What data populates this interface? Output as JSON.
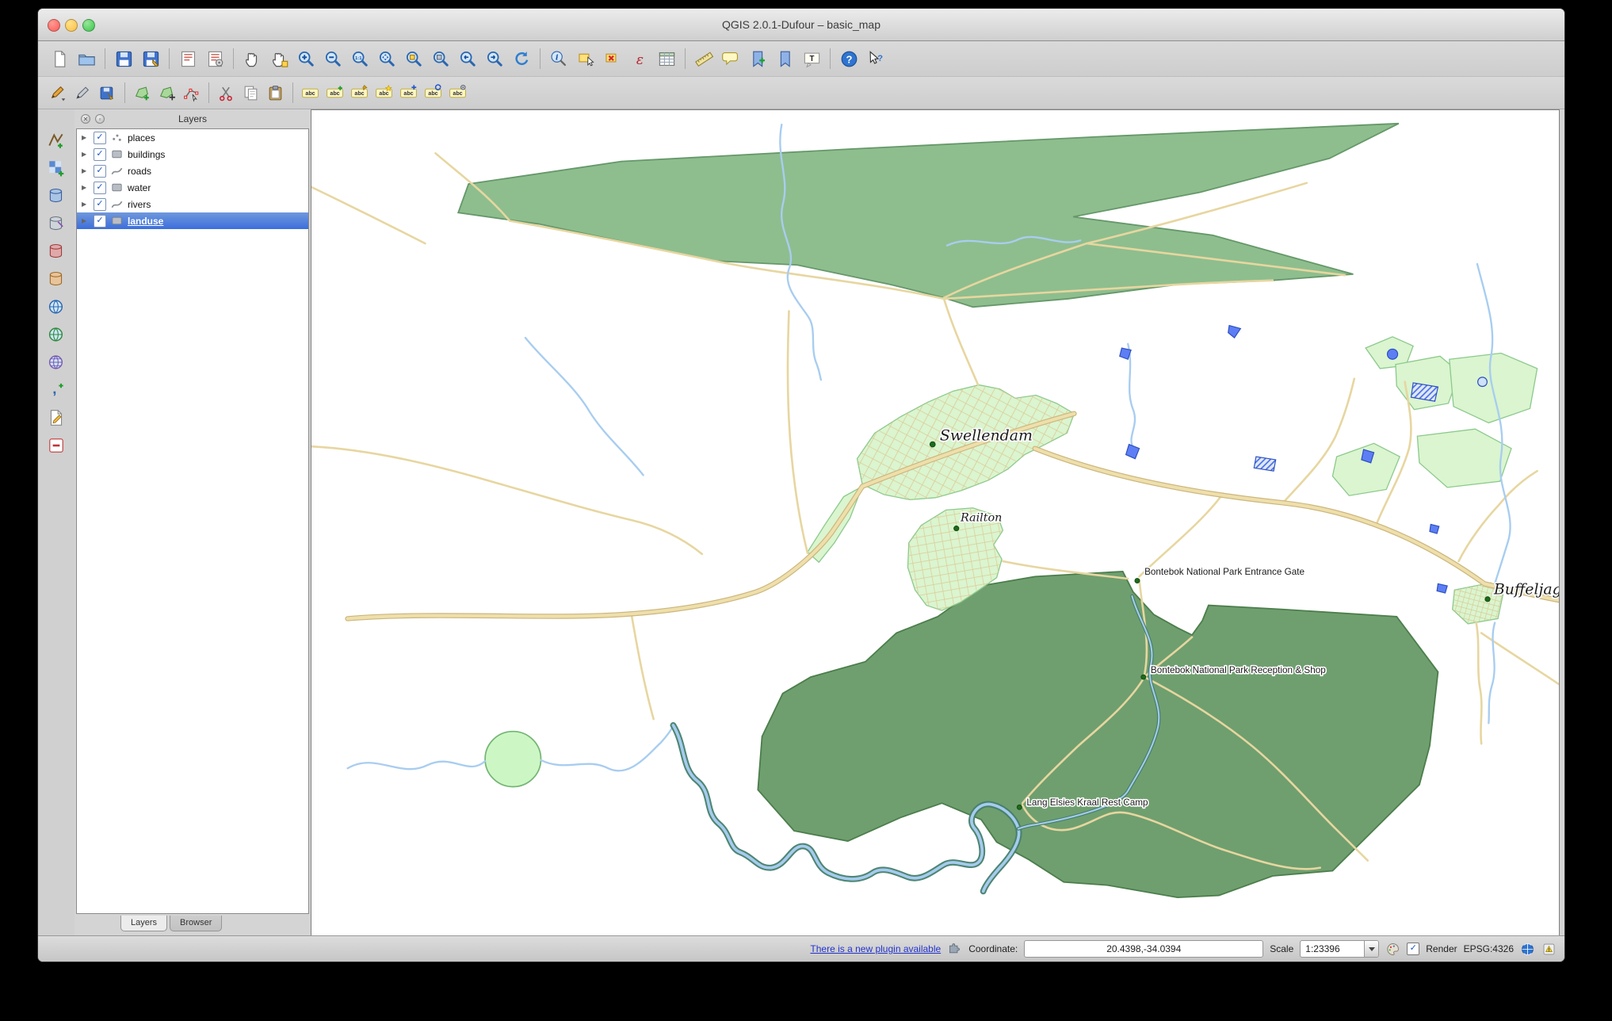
{
  "window": {
    "title": "QGIS 2.0.1-Dufour – basic_map"
  },
  "toolbar_main": {
    "items": [
      {
        "name": "new-project-button",
        "icon": "page"
      },
      {
        "name": "open-project-button",
        "icon": "folder"
      },
      {
        "sep": true
      },
      {
        "name": "save-project-button",
        "icon": "floppy"
      },
      {
        "name": "save-project-as-button",
        "icon": "floppy-edit"
      },
      {
        "sep": true
      },
      {
        "name": "new-print-composer-button",
        "icon": "composer"
      },
      {
        "name": "composer-manager-button",
        "icon": "composer-mgr"
      },
      {
        "sep": true
      },
      {
        "name": "pan-map-button",
        "icon": "hand"
      },
      {
        "name": "pan-to-selection-button",
        "icon": "hand-sel"
      },
      {
        "name": "zoom-in-button",
        "icon": "mag-plus"
      },
      {
        "name": "zoom-out-button",
        "icon": "mag-minus"
      },
      {
        "name": "zoom-native-button",
        "icon": "mag-native"
      },
      {
        "name": "zoom-full-button",
        "icon": "mag-full"
      },
      {
        "name": "zoom-to-selection-button",
        "icon": "mag-sel"
      },
      {
        "name": "zoom-to-layer-button",
        "icon": "mag-layer"
      },
      {
        "name": "zoom-last-button",
        "icon": "mag-prev"
      },
      {
        "name": "zoom-next-button",
        "icon": "mag-next"
      },
      {
        "name": "refresh-map-button",
        "icon": "refresh"
      },
      {
        "sep": true
      },
      {
        "name": "identify-features-button",
        "icon": "identify"
      },
      {
        "name": "select-features-button",
        "icon": "select"
      },
      {
        "name": "deselect-features-button",
        "icon": "deselect"
      },
      {
        "name": "select-by-expression-button",
        "icon": "epsilon"
      },
      {
        "name": "open-attribute-table-button",
        "icon": "table"
      },
      {
        "sep": true
      },
      {
        "name": "measure-line-button",
        "icon": "ruler"
      },
      {
        "name": "map-tips-button",
        "icon": "bubble"
      },
      {
        "name": "new-bookmark-button",
        "icon": "bookmark-plus"
      },
      {
        "name": "show-bookmarks-button",
        "icon": "bookmark"
      },
      {
        "name": "text-annotation-button",
        "icon": "text-annot"
      },
      {
        "sep": true
      },
      {
        "name": "help-button",
        "icon": "help"
      },
      {
        "name": "whats-this-button",
        "icon": "whats-this"
      }
    ]
  },
  "toolbar_edit": {
    "items": [
      {
        "name": "current-edits-button",
        "icon": "pencil-menu"
      },
      {
        "name": "toggle-editing-button",
        "icon": "pencil"
      },
      {
        "name": "save-layer-edits-button",
        "icon": "floppy-pencil"
      },
      {
        "sep": true
      },
      {
        "name": "add-feature-button",
        "icon": "poly-plus"
      },
      {
        "name": "move-feature-button",
        "icon": "poly-move"
      },
      {
        "name": "node-tool-button",
        "icon": "node"
      },
      {
        "sep": true
      },
      {
        "name": "cut-features-button",
        "icon": "scissors"
      },
      {
        "name": "copy-features-button",
        "icon": "copy"
      },
      {
        "name": "paste-features-button",
        "icon": "paste"
      },
      {
        "sep": true
      },
      {
        "name": "layer-labeling-button",
        "icon": "abc"
      },
      {
        "name": "label-add-button",
        "icon": "abc-plus"
      },
      {
        "name": "label-pin-button",
        "icon": "abc-pin"
      },
      {
        "name": "label-highlight-button",
        "icon": "abc-high"
      },
      {
        "name": "label-move-button",
        "icon": "abc-move"
      },
      {
        "name": "label-rotate-button",
        "icon": "abc-rot"
      },
      {
        "name": "label-properties-button",
        "icon": "abc-props"
      }
    ]
  },
  "layers_toolbar": {
    "items": [
      {
        "name": "add-vector-layer-button",
        "icon": "lyr-vector"
      },
      {
        "name": "add-raster-layer-button",
        "icon": "lyr-raster"
      },
      {
        "name": "add-postgis-layer-button",
        "icon": "lyr-db-blue"
      },
      {
        "name": "add-spatialite-layer-button",
        "icon": "lyr-db-grey"
      },
      {
        "name": "add-mssql-layer-button",
        "icon": "lyr-db-red"
      },
      {
        "name": "add-oracle-layer-button",
        "icon": "lyr-db-orange"
      },
      {
        "name": "add-wms-layer-button",
        "icon": "lyr-globe"
      },
      {
        "name": "add-wfs-layer-button",
        "icon": "lyr-globe-green"
      },
      {
        "name": "add-wcs-layer-button",
        "icon": "lyr-globe-grid"
      },
      {
        "name": "add-delimited-text-layer-button",
        "icon": "lyr-comma"
      },
      {
        "name": "new-shapefile-button",
        "icon": "lyr-newshp"
      },
      {
        "name": "remove-layer-button",
        "icon": "lyr-remove"
      }
    ]
  },
  "layers_panel": {
    "title": "Layers",
    "tabs": [
      {
        "label": "Layers",
        "active": true
      },
      {
        "label": "Browser",
        "active": false
      }
    ],
    "layers": [
      {
        "name": "places",
        "type": "marker",
        "checked": true,
        "selected": false
      },
      {
        "name": "buildings",
        "type": "polygon",
        "checked": true,
        "selected": false
      },
      {
        "name": "roads",
        "type": "line",
        "checked": true,
        "selected": false
      },
      {
        "name": "water",
        "type": "polygon",
        "checked": true,
        "selected": false
      },
      {
        "name": "rivers",
        "type": "line",
        "checked": true,
        "selected": false
      },
      {
        "name": "landuse",
        "type": "polygon",
        "checked": true,
        "selected": true
      }
    ]
  },
  "map": {
    "labels": [
      "Swellendam",
      "Railton",
      "Bontebok National Park Entrance Gate",
      "Bontebok National Park Reception & Shop",
      "Lang Elsies Kraal Rest Camp",
      "Buffeljagsrivier"
    ]
  },
  "status_bar": {
    "plugin_link": "There is a new plugin available",
    "coordinate_label": "Coordinate:",
    "coordinate_value": "20.4398,-34.0394",
    "scale_label": "Scale",
    "scale_value": "1:23396",
    "render_label": "Render",
    "epsg_label": "EPSG:4326"
  },
  "colors": {
    "selection": "#3c6edc",
    "forest": "#8ebe8e",
    "park": "#6f9f6f",
    "urban": "#daf5cf",
    "water": "#5d7ef5",
    "road": "#e7d6a0",
    "river": "#a6cbee"
  }
}
